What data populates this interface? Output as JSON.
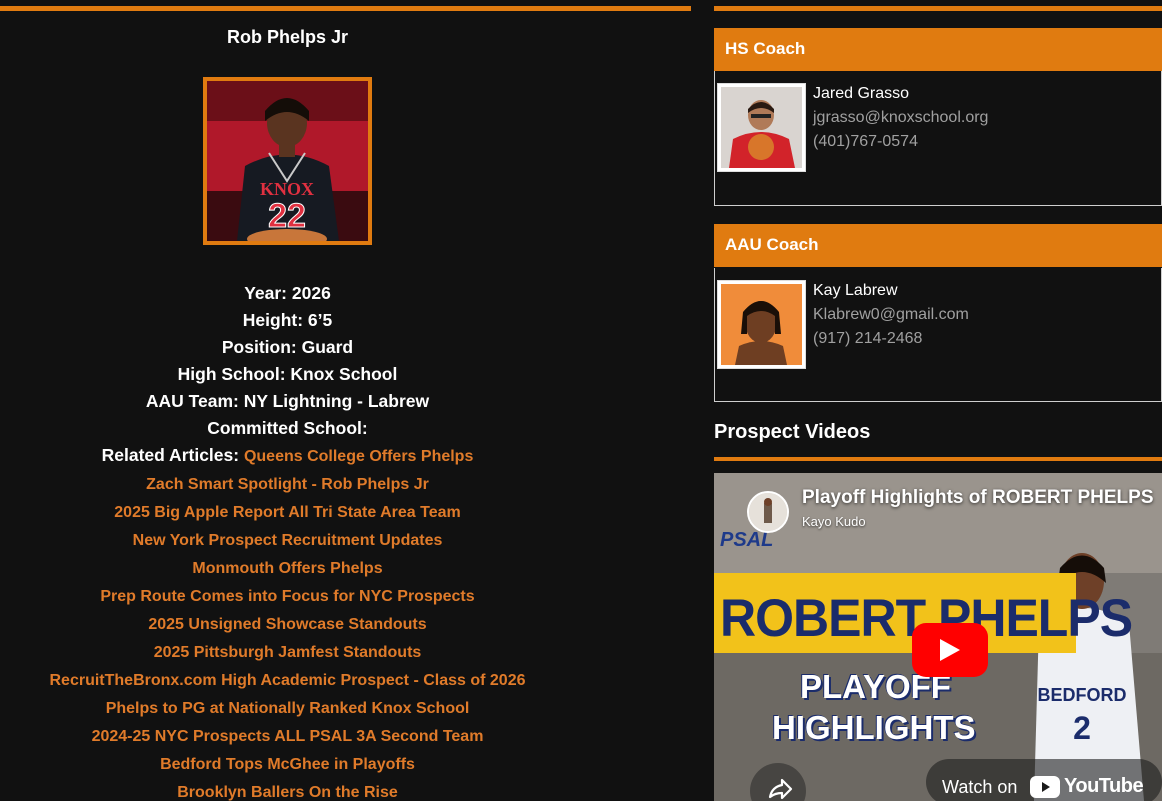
{
  "player": {
    "name": "Rob Phelps Jr",
    "year_label": "Year: ",
    "year": "2026",
    "height_label": "Height: ",
    "height": "6’5",
    "position_label": "Position: ",
    "position": "Guard",
    "school_label": "High School: ",
    "school": "Knox School",
    "aau_label": "AAU Team: ",
    "aau": "NY Lightning - Labrew",
    "committed_label": "Committed School:",
    "related_label": "Related Articles: ",
    "articles": [
      "Queens College Offers Phelps",
      "Zach Smart Spotlight - Rob Phelps Jr",
      "2025 Big Apple Report All Tri State Area Team",
      "New York Prospect Recruitment Updates",
      "Monmouth Offers Phelps",
      "Prep Route Comes into Focus for NYC Prospects",
      "2025 Unsigned Showcase Standouts",
      "2025 Pittsburgh Jamfest Standouts",
      "RecruitTheBronx.com High Academic Prospect - Class of 2026",
      "Phelps to PG at Nationally Ranked Knox School",
      "2024-25 NYC Prospects ALL PSAL 3A Second Team",
      "Bedford Tops McGhee in Playoffs",
      "Brooklyn Ballers On the Rise"
    ],
    "jersey_text": "KNOX",
    "jersey_number": "22"
  },
  "hs_coach": {
    "heading": "HS Coach",
    "name": "Jared Grasso",
    "email": "jgrasso@knoxschool.org",
    "phone": "(401)767-0574"
  },
  "aau_coach": {
    "heading": "AAU Coach",
    "name": "Kay Labrew",
    "email": "Klabrew0@gmail.com",
    "phone": "(917) 214-2468"
  },
  "videos": {
    "heading": "Prospect Videos",
    "title": "Playoff Highlights of ROBERT PHELPS",
    "channel": "Kayo Kudo",
    "thumb_logo": "PSAL",
    "thumb_name": "ROBERT PHELPS",
    "thumb_line1": "PLAYOFF",
    "thumb_line2": "HIGHLIGHTS",
    "thumb_jersey": "BEDFORD",
    "thumb_number": "2",
    "watch_label": "Watch on",
    "yt_label": "YouTube"
  },
  "colors": {
    "accent": "#e07b10",
    "background": "#111111",
    "link": "#e07b2a",
    "muted": "#a0a0a0"
  }
}
